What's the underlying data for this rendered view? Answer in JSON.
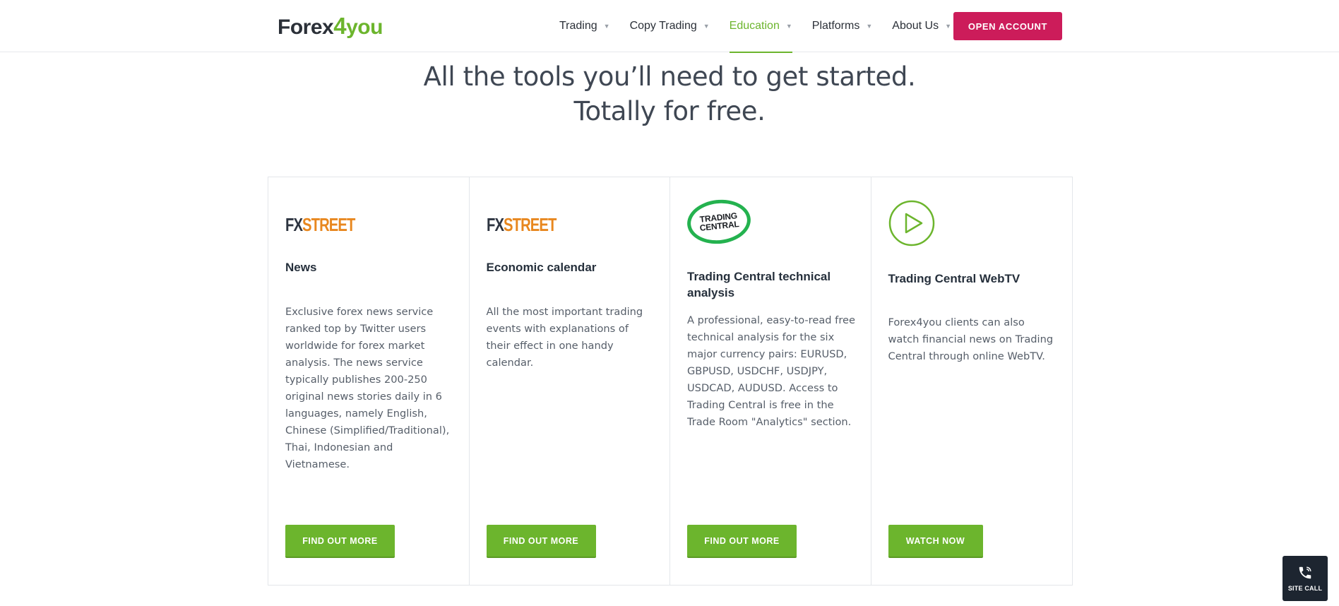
{
  "header": {
    "logo": {
      "part1": "Forex",
      "part2": "4",
      "part3": "you"
    },
    "nav": [
      {
        "label": "Trading"
      },
      {
        "label": "Copy Trading"
      },
      {
        "label": "Education"
      },
      {
        "label": "Platforms"
      },
      {
        "label": "About Us"
      }
    ],
    "nav_active": "Education",
    "open_account_label": "OPEN ACCOUNT",
    "colors": {
      "accent": "#6cb52d",
      "cta": "#cc1c5a"
    }
  },
  "hero": {
    "line1": "All the tools you’ll need to get started.",
    "line2": "Totally for free."
  },
  "cards": [
    {
      "logo": {
        "part1": "FX",
        "part2": "STREET"
      },
      "title": "News",
      "text": "Exclusive forex news service ranked top by Twitter users worldwide for forex market analysis. The news service typically publishes 200-250 original news stories daily in 6 languages, namely English, Chinese (Simplified/Traditional), Thai, Indonesian and Vietnamese.",
      "button": "FIND OUT MORE"
    },
    {
      "logo": {
        "part1": "FX",
        "part2": "STREET"
      },
      "title": "Economic calendar",
      "text": "All the most important trading events with explanations of their effect in one handy calendar.",
      "button": "FIND OUT MORE"
    },
    {
      "logo": {
        "line1": "TRADING",
        "line2": "CENTRAL"
      },
      "title": "Trading Central technical analysis",
      "text": "A professional, easy-to-read free technical analysis for the six major currency pairs: EURUSD, GBPUSD, USDCHF, USDJPY, USDCAD, AUDUSD. Access to Trading Central is free in the Trade Room \"Analytics\" section.",
      "button": "FIND OUT MORE"
    },
    {
      "logo_icon": "play-circle-icon",
      "title": "Trading Central WebTV",
      "text": "Forex4you clients can also watch financial news on Trading Central through online WebTV.",
      "button": "WATCH NOW"
    }
  ],
  "site_call": {
    "label": "SITE CALL",
    "icon": "phone-icon"
  }
}
